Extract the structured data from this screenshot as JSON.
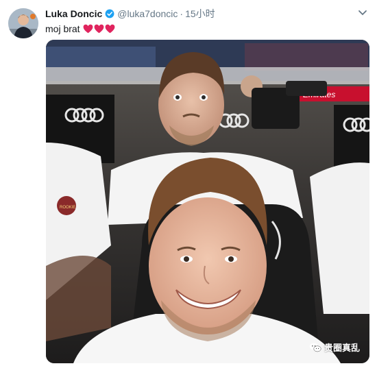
{
  "tweet": {
    "display_name": "Luka Doncic",
    "handle": "@luka7doncic",
    "separator": "·",
    "timestamp": "15小时",
    "text": "moj brat",
    "emoji": [
      "red-heart",
      "red-heart",
      "red-heart"
    ],
    "verified": true
  },
  "media": {
    "description_icon": "photo",
    "banner_text": "Emirates",
    "shirt_badge_text": "ROOKIE"
  },
  "watermark": {
    "text": "贵圈真乱",
    "icon": "wechat-icon"
  },
  "colors": {
    "name": "#14171a",
    "secondary": "#657786",
    "verified": "#1da1f2",
    "heart": "#e0245e"
  }
}
